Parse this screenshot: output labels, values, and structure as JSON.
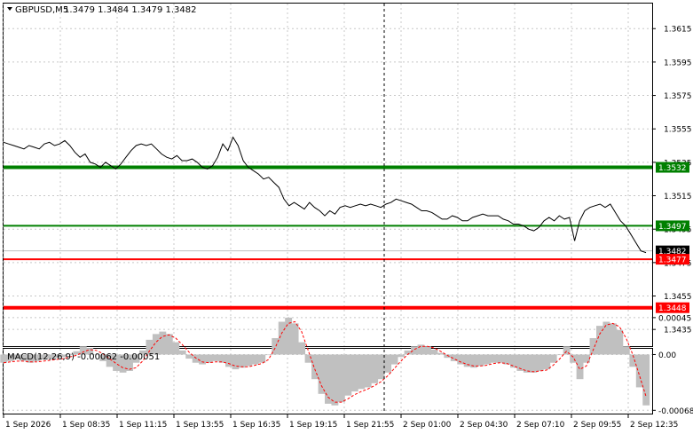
{
  "header": {
    "symbol": "GBPUSD,M5",
    "ohlc": "1.3479 1.3484 1.3479 1.3482"
  },
  "macd_header": "MACD(12,26,9) -0.00062 -0.00051",
  "chart_data": [
    {
      "type": "line",
      "title": "GBPUSD,M5 1.3479 1.3484 1.3479 1.3482",
      "ylim": [
        1.3425,
        1.363
      ],
      "y_ticks": [
        "1.3615",
        "1.3595",
        "1.3575",
        "1.3555",
        "1.3535",
        "1.3515",
        "1.3495",
        "1.3475",
        "1.3455",
        "1.3435"
      ],
      "x_ticks": [
        "1 Sep 2026",
        "1 Sep 08:35",
        "1 Sep 11:15",
        "1 Sep 13:55",
        "1 Sep 16:35",
        "1 Sep 19:15",
        "1 Sep 21:55",
        "2 Sep 01:00",
        "2 Sep 04:30",
        "2 Sep 07:10",
        "2 Sep 09:55",
        "2 Sep 12:35"
      ],
      "series": [
        {
          "color": "#000000",
          "values": [
            1.3547,
            1.3546,
            1.3545,
            1.3544,
            1.3543,
            1.3545,
            1.3544,
            1.3543,
            1.3546,
            1.3547,
            1.3545,
            1.3546,
            1.3548,
            1.3545,
            1.3541,
            1.3538,
            1.354,
            1.3535,
            1.3534,
            1.3532,
            1.3535,
            1.3533,
            1.3531,
            1.3534,
            1.3538,
            1.3542,
            1.3545,
            1.3546,
            1.3545,
            1.3546,
            1.3543,
            1.354,
            1.3538,
            1.3537,
            1.3539,
            1.3536,
            1.3536,
            1.3537,
            1.3535,
            1.3532,
            1.3531,
            1.3533,
            1.3538,
            1.3546,
            1.3542,
            1.355,
            1.3545,
            1.3536,
            1.3532,
            1.353,
            1.3528,
            1.3525,
            1.3526,
            1.3523,
            1.352,
            1.3513,
            1.3509,
            1.3511,
            1.3509,
            1.3507,
            1.3511,
            1.3508,
            1.3506,
            1.3503,
            1.3506,
            1.3504,
            1.3508,
            1.3509,
            1.3508,
            1.3509,
            1.351,
            1.3509,
            1.351,
            1.3509,
            1.3508,
            1.351,
            1.3511,
            1.3513,
            1.3512,
            1.3511,
            1.351,
            1.3508,
            1.3506,
            1.3506,
            1.3505,
            1.3503,
            1.3501,
            1.3501,
            1.3503,
            1.3502,
            1.35,
            1.35,
            1.3502,
            1.3503,
            1.3504,
            1.3503,
            1.3503,
            1.3503,
            1.3501,
            1.35,
            1.3498,
            1.3498,
            1.3497,
            1.3495,
            1.3494,
            1.3496,
            1.35,
            1.3502,
            1.35,
            1.3503,
            1.3501,
            1.3502,
            1.3488,
            1.35,
            1.3506,
            1.3508,
            1.3509,
            1.351,
            1.3508,
            1.351,
            1.3505,
            1.35,
            1.3497,
            1.3492,
            1.3487,
            1.3482,
            1.3481
          ]
        },
        {
          "name": "1.3532",
          "value": 1.3532,
          "color": "#008000"
        },
        {
          "name": "1.3497",
          "value": 1.3497,
          "color": "#008000"
        },
        {
          "name": "1.3482",
          "value": 1.3482,
          "color": "#000000"
        },
        {
          "name": "1.3477",
          "value": 1.3477,
          "color": "#ff0000"
        },
        {
          "name": "1.3448",
          "value": 1.3448,
          "color": "#ff0000"
        }
      ]
    },
    {
      "type": "bar",
      "title": "MACD(12,26,9) -0.00062 -0.00051",
      "ylim": [
        -0.00072,
        7e-05
      ],
      "y_ticks": [
        "0.00045",
        "0.00",
        "-0.00068"
      ],
      "series": [
        {
          "name": "MACD",
          "color": "#c0c0c0",
          "values": [
            -0.0001,
            -8e-05,
            -6e-05,
            -8e-05,
            -0.0001,
            -8e-05,
            -6e-05,
            -5e-05,
            -4e-05,
            -3e-05,
            1e-05,
            4e-05,
            0.0001,
            8e-05,
            0.0,
            -8e-05,
            -0.00015,
            -0.0002,
            -0.00022,
            -0.0002,
            -0.0001,
            5e-05,
            0.00018,
            0.00025,
            0.00028,
            0.00025,
            0.00015,
            5e-05,
            -5e-05,
            -0.0001,
            -0.00012,
            -0.0001,
            -8e-05,
            -0.0001,
            -0.00015,
            -0.00018,
            -0.00016,
            -0.00014,
            -0.00012,
            -0.0001,
            0.0,
            0.0002,
            0.0004,
            0.00045,
            0.00038,
            0.00015,
            -0.0001,
            -0.0003,
            -0.00048,
            -0.0006,
            -0.00062,
            -0.00058,
            -0.0005,
            -0.00045,
            -0.00042,
            -0.0004,
            -0.00035,
            -0.0003,
            -0.00022,
            -0.00012,
            -3e-05,
            5e-05,
            0.0001,
            0.00012,
            0.0001,
            6e-05,
            2e-05,
            -4e-05,
            -8e-05,
            -0.00012,
            -0.00015,
            -0.00016,
            -0.00014,
            -0.00012,
            -0.0001,
            -0.0001,
            -0.00012,
            -0.00016,
            -0.0002,
            -0.00022,
            -0.00022,
            -0.0002,
            -0.00018,
            -0.0001,
            0.0,
            0.0001,
            -0.0001,
            -0.0003,
            -0.0001,
            0.0002,
            0.00035,
            0.0004,
            0.00038,
            0.0003,
            0.0001,
            -0.00015,
            -0.0004,
            -0.00062
          ]
        },
        {
          "name": "Signal",
          "color": "#ff0000",
          "values": [
            -0.0001,
            -9e-05,
            -8e-05,
            -8e-05,
            -9e-05,
            -9e-05,
            -8e-05,
            -7e-05,
            -6e-05,
            -5e-05,
            -3e-05,
            -1e-05,
            3e-05,
            6e-05,
            5e-05,
            1e-05,
            -5e-05,
            -0.00011,
            -0.00016,
            -0.00018,
            -0.00016,
            -8e-05,
            4e-05,
            0.00015,
            0.00022,
            0.00024,
            0.0002,
            0.00012,
            3e-05,
            -4e-05,
            -9e-05,
            -0.0001,
            -9e-05,
            -9e-05,
            -0.00011,
            -0.00014,
            -0.00015,
            -0.00015,
            -0.00013,
            -0.00011,
            -6e-05,
            8e-05,
            0.00026,
            0.00038,
            0.0004,
            0.00028,
            5e-05,
            -0.00018,
            -0.00038,
            -0.00052,
            -0.00058,
            -0.00058,
            -0.00054,
            -0.00049,
            -0.00045,
            -0.00042,
            -0.00038,
            -0.00033,
            -0.00026,
            -0.00017,
            -8e-05,
            0.0,
            6e-05,
            0.0001,
            0.0001,
            8e-05,
            4e-05,
            -1e-05,
            -5e-05,
            -9e-05,
            -0.00012,
            -0.00014,
            -0.00014,
            -0.00013,
            -0.00011,
            -0.0001,
            -0.00011,
            -0.00014,
            -0.00017,
            -0.0002,
            -0.00021,
            -0.0002,
            -0.00019,
            -0.00013,
            -5e-05,
            4e-05,
            -3e-05,
            -0.00018,
            -0.00014,
            5e-05,
            0.00025,
            0.00036,
            0.00038,
            0.00034,
            0.0002,
            0.0,
            -0.00025,
            -0.00051
          ]
        }
      ]
    }
  ]
}
